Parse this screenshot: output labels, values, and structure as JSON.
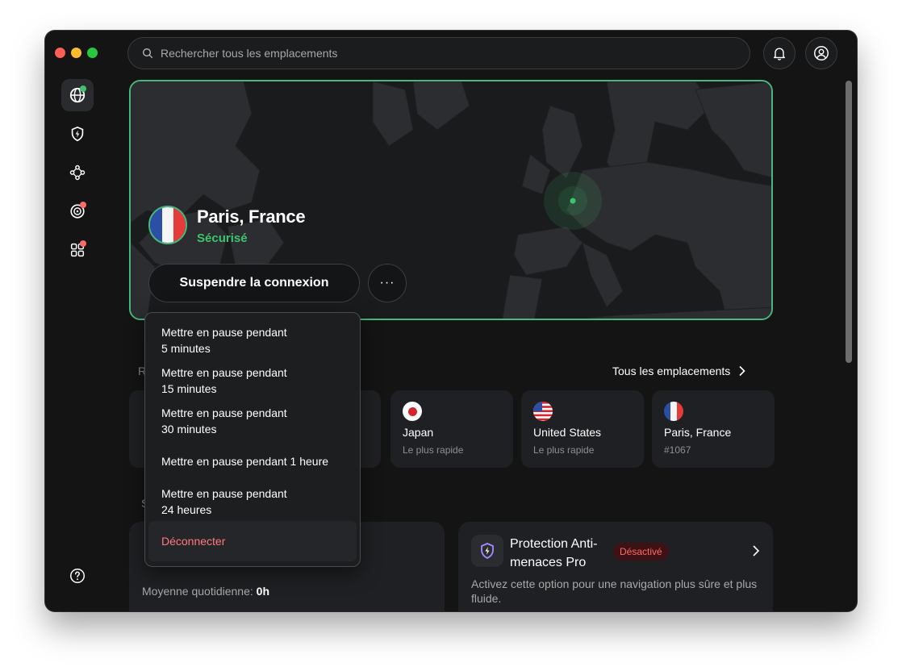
{
  "search": {
    "placeholder": "Rechercher tous les emplacements"
  },
  "hero": {
    "location": "Paris, France",
    "status": "Sécurisé",
    "suspend_label": "Suspendre la connexion",
    "more_label": "···"
  },
  "pause_menu": {
    "items": [
      {
        "line1": "Mettre en pause pendant",
        "line2": "5 minutes"
      },
      {
        "line1": "Mettre en pause pendant",
        "line2": "15 minutes"
      },
      {
        "line1": "Mettre en pause pendant",
        "line2": "30 minutes"
      },
      {
        "line1": "Mettre en pause pendant 1 heure",
        "line2": ""
      },
      {
        "line1": "Mettre en pause pendant",
        "line2": "24 heures"
      }
    ],
    "disconnect": "Déconnecter"
  },
  "recent": {
    "all_locations": "Tous les emplacements",
    "cards": [
      {
        "name": "Japan",
        "sub": "Le plus rapide"
      },
      {
        "name": "United States",
        "sub": "Le plus rapide"
      },
      {
        "name": "Paris, France",
        "sub": "#1067"
      }
    ]
  },
  "stats": {
    "label": "Moyenne quotidienne:",
    "value": "0h"
  },
  "threat_protection": {
    "title": "Protection Anti-menaces Pro",
    "badge": "Désactivé",
    "description": "Activez cette option pour une navigation plus sûre et plus fluide."
  },
  "colors": {
    "accent_green": "#3dc46e",
    "danger": "#ff7a7a",
    "badge_bg": "#3e1114"
  }
}
